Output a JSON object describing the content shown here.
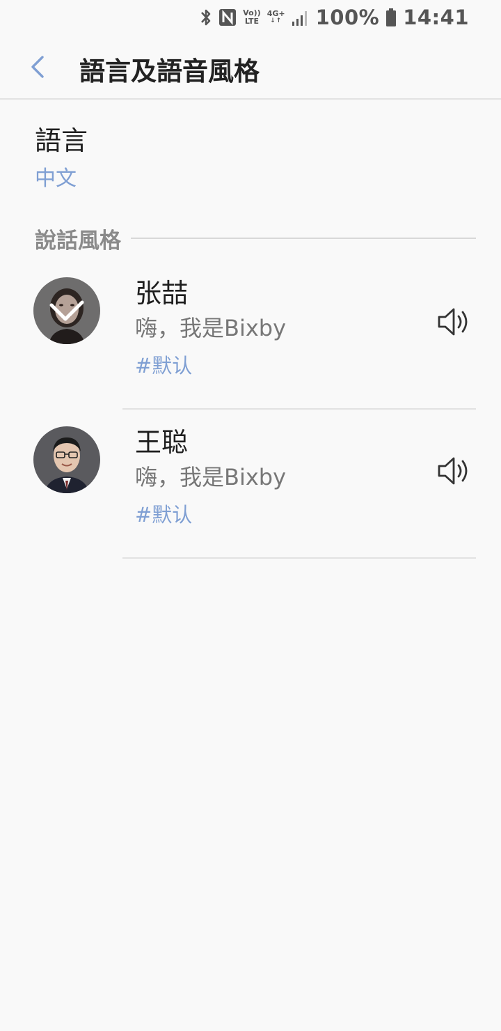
{
  "status_bar": {
    "volte_top": "Vo))",
    "volte_bottom": "LTE",
    "network": "4G+",
    "network_arrows": "↓↑",
    "battery_percent": "100%",
    "time": "14:41",
    "icons": [
      "bluetooth-icon",
      "nfc-icon",
      "volte-icon",
      "network-4g-icon",
      "signal-icon",
      "battery-icon"
    ]
  },
  "header": {
    "title": "語言及語音風格",
    "back_icon": "chevron-left-icon",
    "accent_color": "#7f9fd3"
  },
  "language": {
    "label": "語言",
    "value": "中文"
  },
  "speaking_style": {
    "title": "說話風格",
    "voices": [
      {
        "name": "张喆",
        "greeting": "嗨，我是Bixby",
        "tag": "#默认",
        "selected": true,
        "avatar_icon": "female-avatar",
        "speaker_icon": "speaker-icon"
      },
      {
        "name": "王聪",
        "greeting": "嗨，我是Bixby",
        "tag": "#默认",
        "selected": false,
        "avatar_icon": "male-avatar",
        "speaker_icon": "speaker-icon"
      }
    ]
  },
  "colors": {
    "background": "#f9f9f9",
    "accent": "#7f9fd3",
    "secondary_text": "#777777"
  }
}
